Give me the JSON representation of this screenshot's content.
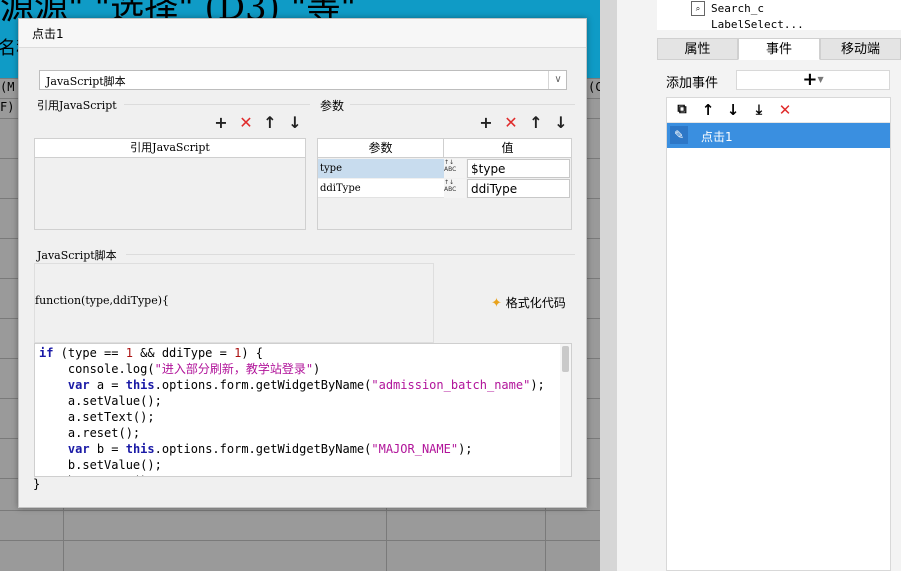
{
  "background": {
    "header_text": "源源\"  \"选择\"   (D3)   \"等\"",
    "name_fragment": "名称",
    "row_text_1": "(M",
    "row_text_2": "F)",
    "row_text_3": "(C"
  },
  "right_panel": {
    "tree_items": [
      "Search_c",
      "LabelSelect..."
    ],
    "tabs": [
      "属性",
      "事件",
      "移动端"
    ],
    "active_tab": "事件",
    "add_event_label": "添加事件",
    "add_event_symbol": "+",
    "toolbar_icons": [
      "copy-icon",
      "arrow-up-icon",
      "arrow-down-icon",
      "move-bottom-icon",
      "delete-icon"
    ],
    "events": [
      {
        "label": "点击1",
        "selected": true
      }
    ],
    "accent_color": "#3a8fe0"
  },
  "dialog": {
    "title": "点击1",
    "type_select": "JavaScript脚本",
    "ref_section": {
      "label": "引用JavaScript",
      "column": "引用JavaScript"
    },
    "param_section": {
      "label": "参数",
      "columns": [
        "参数",
        "值"
      ],
      "rows": [
        {
          "name": "type",
          "value": "$type",
          "type_icon": "ABC"
        },
        {
          "name": "ddiType",
          "value": "ddiType",
          "type_icon": "ABC"
        }
      ]
    },
    "script_section": {
      "label": "JavaScript脚本",
      "signature": "function(type,ddiType){",
      "format_button": "格式化代码",
      "code_lines": [
        "if (type == 1 && ddiType = 1) {",
        "    console.log(\"进入部分刷新，教学站登录\")",
        "    var a = this.options.form.getWidgetByName(\"admission_batch_name\");",
        "    a.setValue();",
        "    a.setText();",
        "    a.reset();",
        "    var b = this.options.form.getWidgetByName(\"MAJOR_NAME\");",
        "    b.setValue();",
        "    b.setText();"
      ],
      "closing": "}"
    }
  }
}
